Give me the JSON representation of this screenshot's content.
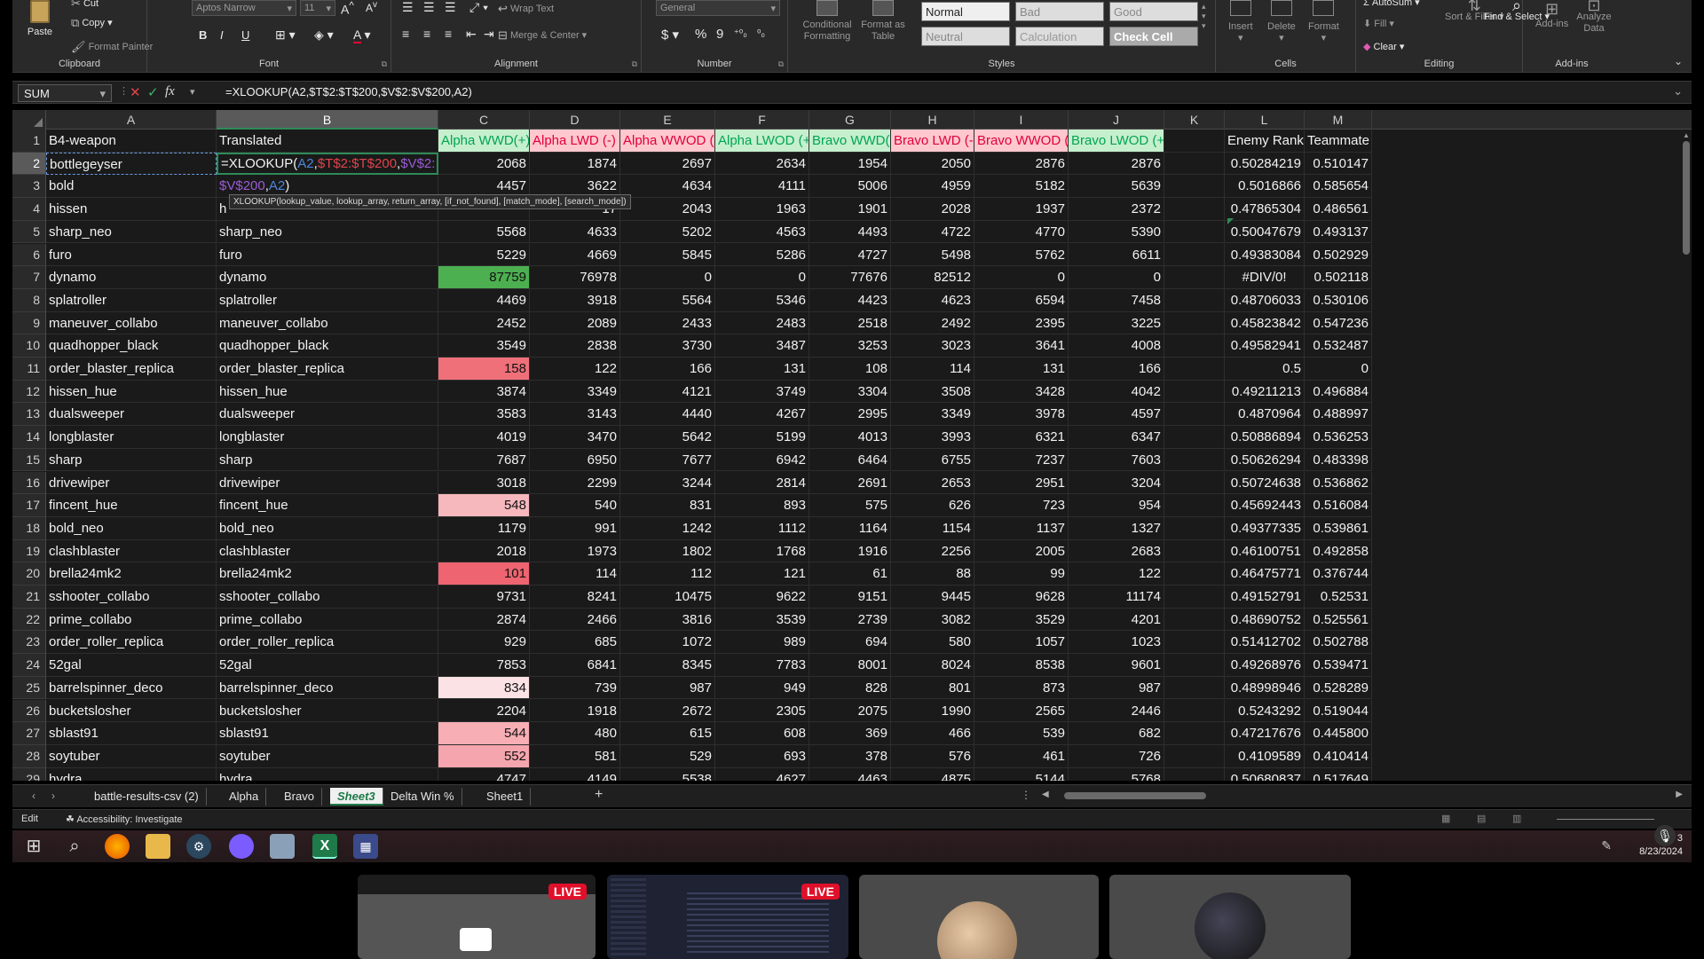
{
  "ribbon": {
    "clipboard": {
      "cut": "Cut",
      "copy": "Copy",
      "format_painter": "Format Painter",
      "paste": "Paste",
      "label": "Clipboard"
    },
    "font": {
      "family": "Aptos Narrow",
      "size": "11",
      "label": "Font",
      "bold": "B",
      "italic": "I",
      "underline": "U"
    },
    "alignment": {
      "wrap": "Wrap Text",
      "merge": "Merge & Center",
      "label": "Alignment"
    },
    "number": {
      "format": "General",
      "currency": "$",
      "percent": "%",
      "comma": "9",
      "label": "Number"
    },
    "styles": {
      "conditional": "Conditional Formatting",
      "format_table": "Format as Table",
      "label": "Styles",
      "cells": [
        {
          "name": "Normal"
        },
        {
          "name": "Bad"
        },
        {
          "name": "Good"
        },
        {
          "name": "Neutral"
        },
        {
          "name": "Calculation"
        },
        {
          "name": "Check Cell"
        }
      ]
    },
    "cells": {
      "insert": "Insert",
      "delete": "Delete",
      "format": "Format",
      "label": "Cells"
    },
    "editing": {
      "autosum": "AutoSum",
      "fill": "Fill",
      "clear": "Clear",
      "sort": "Sort & Filter",
      "find": "Find & Select",
      "label": "Editing"
    },
    "addins": {
      "addins": "Add-ins",
      "analyze": "Analyze Data",
      "label": "Add-ins"
    }
  },
  "formula_bar": {
    "name_box": "SUM",
    "formula": "=XLOOKUP(A2,$T$2:$T$200,$V$2:$V$200,A2)"
  },
  "columns": [
    "A",
    "B",
    "C",
    "D",
    "E",
    "F",
    "G",
    "H",
    "I",
    "J",
    "K",
    "L",
    "M"
  ],
  "header_row": {
    "a": "B4-weapon",
    "b": "Translated",
    "c": "Alpha WWD(+)",
    "d": "Alpha LWD (-)",
    "e": "Alpha WWOD (-)",
    "f": "Alpha LWOD (+)",
    "g": "Bravo WWD(+",
    "h": "Bravo LWD (-)",
    "i": "Bravo WWOD (-)",
    "j": "Bravo LWOD (+)",
    "k": "",
    "l": "Enemy Rank",
    "m": "Teammate"
  },
  "editing_cell": {
    "line1_prefix": "=XLOOKUP(",
    "arg1": "A2",
    "arg2": "$T$2:$T$200",
    "arg3_part1": "$V$2:",
    "arg3_part2": "$V$200",
    "arg4": "A2",
    "suffix": ")",
    "tooltip": "XLOOKUP(lookup_value, lookup_array, return_array, [if_not_found], [match_mode], [search_mode])"
  },
  "rows": [
    {
      "n": "2",
      "a": "bottlegeyser",
      "b": "",
      "c": "2068",
      "d": "1874",
      "e": "2697",
      "f": "2634",
      "g": "1954",
      "h": "2050",
      "i": "2876",
      "j": "2876",
      "l": "0.50284219",
      "m": "0.510147"
    },
    {
      "n": "3",
      "a": "bold",
      "b": "",
      "c": "4457",
      "d": "3622",
      "e": "4634",
      "f": "4111",
      "g": "5006",
      "h": "4959",
      "i": "5182",
      "j": "5639",
      "l": "0.5016866",
      "m": "0.585654"
    },
    {
      "n": "4",
      "a": "hissen",
      "b": "h",
      "c": "",
      "d": "17",
      "e": "2043",
      "f": "1963",
      "g": "1901",
      "h": "2028",
      "i": "1937",
      "j": "2372",
      "l": "0.47865304",
      "m": "0.486561"
    },
    {
      "n": "5",
      "a": "sharp_neo",
      "b": "sharp_neo",
      "c": "5568",
      "d": "4633",
      "e": "5202",
      "f": "4563",
      "g": "4493",
      "h": "4722",
      "i": "4770",
      "j": "5390",
      "l": "0.50047679",
      "m": "0.493137"
    },
    {
      "n": "6",
      "a": "furo",
      "b": "furo",
      "c": "5229",
      "d": "4669",
      "e": "5845",
      "f": "5286",
      "g": "4727",
      "h": "5498",
      "i": "5762",
      "j": "6611",
      "l": "0.49383084",
      "m": "0.502929"
    },
    {
      "n": "7",
      "a": "dynamo",
      "b": "dynamo",
      "c": "87759",
      "d": "76978",
      "e": "0",
      "f": "0",
      "g": "77676",
      "h": "82512",
      "i": "0",
      "j": "0",
      "l": "#DIV/0!",
      "m": "0.502118"
    },
    {
      "n": "8",
      "a": "splatroller",
      "b": "splatroller",
      "c": "4469",
      "d": "3918",
      "e": "5564",
      "f": "5346",
      "g": "4423",
      "h": "4623",
      "i": "6594",
      "j": "7458",
      "l": "0.48706033",
      "m": "0.530106"
    },
    {
      "n": "9",
      "a": "maneuver_collabo",
      "b": "maneuver_collabo",
      "c": "2452",
      "d": "2089",
      "e": "2433",
      "f": "2483",
      "g": "2518",
      "h": "2492",
      "i": "2395",
      "j": "3225",
      "l": "0.45823842",
      "m": "0.547236"
    },
    {
      "n": "10",
      "a": "quadhopper_black",
      "b": "quadhopper_black",
      "c": "3549",
      "d": "2838",
      "e": "3730",
      "f": "3487",
      "g": "3253",
      "h": "3023",
      "i": "3641",
      "j": "4008",
      "l": "0.49582941",
      "m": "0.532487"
    },
    {
      "n": "11",
      "a": "order_blaster_replica",
      "b": "order_blaster_replica",
      "c": "158",
      "d": "122",
      "e": "166",
      "f": "131",
      "g": "108",
      "h": "114",
      "i": "131",
      "j": "166",
      "l": "0.5",
      "m": "0"
    },
    {
      "n": "12",
      "a": "hissen_hue",
      "b": "hissen_hue",
      "c": "3874",
      "d": "3349",
      "e": "4121",
      "f": "3749",
      "g": "3304",
      "h": "3508",
      "i": "3428",
      "j": "4042",
      "l": "0.49211213",
      "m": "0.496884"
    },
    {
      "n": "13",
      "a": "dualsweeper",
      "b": "dualsweeper",
      "c": "3583",
      "d": "3143",
      "e": "4440",
      "f": "4267",
      "g": "2995",
      "h": "3349",
      "i": "3978",
      "j": "4597",
      "l": "0.4870964",
      "m": "0.488997"
    },
    {
      "n": "14",
      "a": "longblaster",
      "b": "longblaster",
      "c": "4019",
      "d": "3470",
      "e": "5642",
      "f": "5199",
      "g": "4013",
      "h": "3993",
      "i": "6321",
      "j": "6347",
      "l": "0.50886894",
      "m": "0.536253"
    },
    {
      "n": "15",
      "a": "sharp",
      "b": "sharp",
      "c": "7687",
      "d": "6950",
      "e": "7677",
      "f": "6942",
      "g": "6464",
      "h": "6755",
      "i": "7237",
      "j": "7603",
      "l": "0.50626294",
      "m": "0.483398"
    },
    {
      "n": "16",
      "a": "drivewiper",
      "b": "drivewiper",
      "c": "3018",
      "d": "2299",
      "e": "3244",
      "f": "2814",
      "g": "2691",
      "h": "2653",
      "i": "2951",
      "j": "3204",
      "l": "0.50724638",
      "m": "0.536862"
    },
    {
      "n": "17",
      "a": "fincent_hue",
      "b": "fincent_hue",
      "c": "548",
      "d": "540",
      "e": "831",
      "f": "893",
      "g": "575",
      "h": "626",
      "i": "723",
      "j": "954",
      "l": "0.45692443",
      "m": "0.516084"
    },
    {
      "n": "18",
      "a": "bold_neo",
      "b": "bold_neo",
      "c": "1179",
      "d": "991",
      "e": "1242",
      "f": "1112",
      "g": "1164",
      "h": "1154",
      "i": "1137",
      "j": "1327",
      "l": "0.49377335",
      "m": "0.539861"
    },
    {
      "n": "19",
      "a": "clashblaster",
      "b": "clashblaster",
      "c": "2018",
      "d": "1973",
      "e": "1802",
      "f": "1768",
      "g": "1916",
      "h": "2256",
      "i": "2005",
      "j": "2683",
      "l": "0.46100751",
      "m": "0.492858"
    },
    {
      "n": "20",
      "a": "brella24mk2",
      "b": "brella24mk2",
      "c": "101",
      "d": "114",
      "e": "112",
      "f": "121",
      "g": "61",
      "h": "88",
      "i": "99",
      "j": "122",
      "l": "0.46475771",
      "m": "0.376744"
    },
    {
      "n": "21",
      "a": "sshooter_collabo",
      "b": "sshooter_collabo",
      "c": "9731",
      "d": "8241",
      "e": "10475",
      "f": "9622",
      "g": "9151",
      "h": "9445",
      "i": "9628",
      "j": "11174",
      "l": "0.49152791",
      "m": "0.52531"
    },
    {
      "n": "22",
      "a": "prime_collabo",
      "b": "prime_collabo",
      "c": "2874",
      "d": "2466",
      "e": "3816",
      "f": "3539",
      "g": "2739",
      "h": "3082",
      "i": "3529",
      "j": "4201",
      "l": "0.48690752",
      "m": "0.525561"
    },
    {
      "n": "23",
      "a": "order_roller_replica",
      "b": "order_roller_replica",
      "c": "929",
      "d": "685",
      "e": "1072",
      "f": "989",
      "g": "694",
      "h": "580",
      "i": "1057",
      "j": "1023",
      "l": "0.51412702",
      "m": "0.502788"
    },
    {
      "n": "24",
      "a": "52gal",
      "b": "52gal",
      "c": "7853",
      "d": "6841",
      "e": "8345",
      "f": "7783",
      "g": "8001",
      "h": "8024",
      "i": "8538",
      "j": "9601",
      "l": "0.49268976",
      "m": "0.539471"
    },
    {
      "n": "25",
      "a": "barrelspinner_deco",
      "b": "barrelspinner_deco",
      "c": "834",
      "d": "739",
      "e": "987",
      "f": "949",
      "g": "828",
      "h": "801",
      "i": "873",
      "j": "987",
      "l": "0.48998946",
      "m": "0.528289"
    },
    {
      "n": "26",
      "a": "bucketslosher",
      "b": "bucketslosher",
      "c": "2204",
      "d": "1918",
      "e": "2672",
      "f": "2305",
      "g": "2075",
      "h": "1990",
      "i": "2565",
      "j": "2446",
      "l": "0.5243292",
      "m": "0.519044"
    },
    {
      "n": "27",
      "a": "sblast91",
      "b": "sblast91",
      "c": "544",
      "d": "480",
      "e": "615",
      "f": "608",
      "g": "369",
      "h": "466",
      "i": "539",
      "j": "682",
      "l": "0.47217676",
      "m": "0.445800"
    },
    {
      "n": "28",
      "a": "soytuber",
      "b": "soytuber",
      "c": "552",
      "d": "581",
      "e": "529",
      "f": "693",
      "g": "378",
      "h": "576",
      "i": "461",
      "j": "726",
      "l": "0.4109589",
      "m": "0.410414"
    },
    {
      "n": "29",
      "a": "hydra",
      "b": "hydra",
      "c": "4747",
      "d": "4149",
      "e": "5538",
      "f": "4627",
      "g": "4463",
      "h": "4875",
      "i": "5144",
      "j": "5768",
      "l": "0.50680837",
      "m": "0.517649"
    }
  ],
  "c_highlight": {
    "7": "#4caf50",
    "11": "#f0707a",
    "17": "#f6b7bd",
    "20": "#ee6470",
    "25": "#fbe2e5",
    "27": "#f7aeb5",
    "28": "#f5a5ad"
  },
  "sheet_tabs": [
    {
      "label": "battle-results-csv (2)",
      "active": false
    },
    {
      "label": "Alpha",
      "active": false
    },
    {
      "label": "Bravo",
      "active": false
    },
    {
      "label": "Sheet3",
      "active": true
    },
    {
      "label": "Delta Win %",
      "active": false
    },
    {
      "label": "Sheet1",
      "active": false
    }
  ],
  "status": {
    "mode": "Edit",
    "accessibility": "Accessibility: Investigate"
  },
  "taskbar": {
    "date": "8/23/2024",
    "time": "3"
  },
  "thumbs": {
    "live1": "LIVE",
    "live2": "LIVE"
  },
  "colors": {
    "accent_green": "#2e8b57",
    "ribbon_bg": "#292929",
    "grid_bg": "#1a1a1a"
  }
}
